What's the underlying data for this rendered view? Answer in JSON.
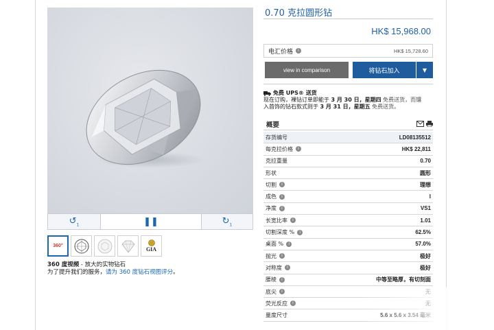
{
  "product": {
    "title": "0.70 克拉圆形钻",
    "price": "HK$ 15,968.00"
  },
  "wire": {
    "label": "电汇价格",
    "value": "HK$ 15,728.60"
  },
  "buttons": {
    "compare": "view in comparison",
    "add": "将钻石加入"
  },
  "shipping": {
    "headline": "免费 UPS® 送货",
    "line1_pre": "现在订购，裸钻订单即能于 ",
    "line1_date": "3 月 30 日，星期四",
    "line1_post": " 免费送货，而镶",
    "line2_pre": "入首饰的钻石款式则于 ",
    "line2_date": "3 月 31 日，星期五",
    "line2_post": " 免费送货。"
  },
  "overview": {
    "title": "概要",
    "rows": [
      {
        "label": "存货编号",
        "value": "LD08135512",
        "info": false,
        "highlight": true
      },
      {
        "label": "每克拉价格",
        "value": "HK$ 22,811",
        "info": true,
        "highlight": false
      },
      {
        "label": "克拉重量",
        "value": "0.70",
        "info": false,
        "highlight": false
      },
      {
        "label": "形状",
        "value": "圆形",
        "info": false,
        "highlight": false
      },
      {
        "label": "切割",
        "value": "理想",
        "info": true,
        "highlight": false
      },
      {
        "label": "成色",
        "value": "I",
        "info": true,
        "highlight": false
      },
      {
        "label": "净度",
        "value": "VS1",
        "info": true,
        "highlight": false
      },
      {
        "label": "长宽比率",
        "value": "1.01",
        "info": true,
        "highlight": false
      },
      {
        "label": "切割深度 %",
        "value": "62.5%",
        "info": true,
        "highlight": false
      },
      {
        "label": "桌面 %",
        "value": "57.0%",
        "info": true,
        "highlight": false
      },
      {
        "label": "抛光",
        "value": "极好",
        "info": true,
        "highlight": false
      },
      {
        "label": "对称度",
        "value": "极好",
        "info": true,
        "highlight": false
      },
      {
        "label": "腰棱",
        "value": "中等至略厚，有切刻面",
        "info": true,
        "highlight": false
      },
      {
        "label": "底尖",
        "value": "无",
        "info": true,
        "highlight": false
      },
      {
        "label": "荧光反应",
        "value": "无",
        "info": true,
        "highlight": false
      },
      {
        "label": "量度尺寸",
        "value": "5.6 x 5.6 x 3.54 毫米",
        "info": false,
        "highlight": false
      }
    ]
  },
  "viewer": {
    "controls": [
      "rotate-left-icon",
      "pause-icon",
      "rotate-right-icon"
    ],
    "rotate_left_sub": "1",
    "rotate_right_sub": "1"
  },
  "thumbnails": [
    {
      "name": "thumb-360",
      "label": "360°"
    },
    {
      "name": "thumb-top-view",
      "label": ""
    },
    {
      "name": "thumb-facet-diagram",
      "label": ""
    },
    {
      "name": "thumb-side-view",
      "label": ""
    },
    {
      "name": "thumb-gia",
      "label": "GIA"
    }
  ],
  "caption": {
    "bold": "360 度视频",
    "rest": " - 放大的实物钻石",
    "line2_pre": "为了提升我们的服务，",
    "line2_link": "请为 360 度钻石视图评分",
    "line2_post": "。"
  },
  "colors": {
    "accent": "#1f5fa8",
    "button_primary": "#1e5c9e",
    "button_secondary": "#6b6b6b"
  }
}
